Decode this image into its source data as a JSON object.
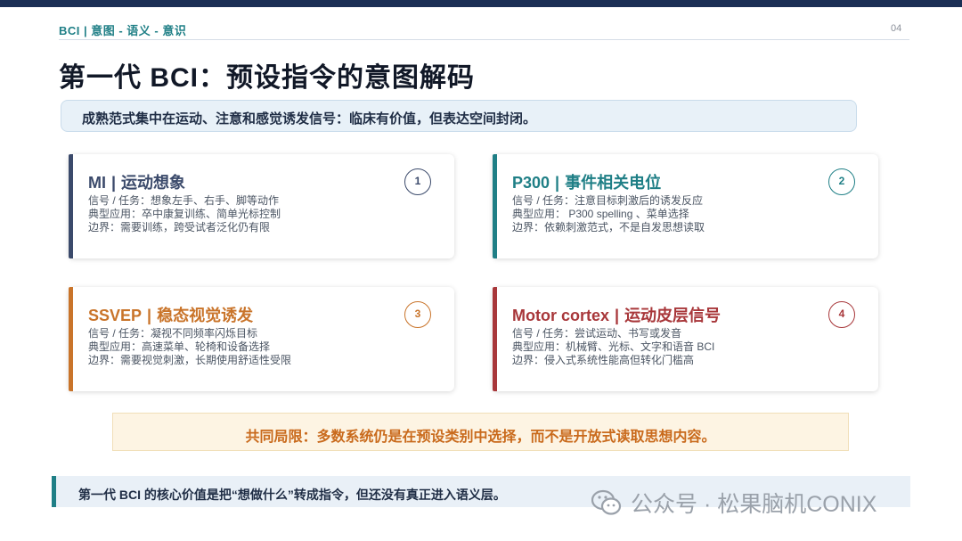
{
  "header": {
    "breadcrumb": "BCI | 意图 - 语义 - 意识",
    "page_number": "04"
  },
  "title": "第一代 BCI：预设指令的意图解码",
  "subtitle": "成熟范式集中在运动、注意和感觉诱发信号：临床有价值，但表达空间封闭。",
  "cards": [
    {
      "abbr": "MI",
      "name": "运动想象",
      "number": "1",
      "color": "#3b4a6b",
      "lines": [
        "信号 / 任务：想象左手、右手、脚等动作",
        "典型应用：卒中康复训练、简单光标控制",
        "边界：需要训练，跨受试者泛化仍有限"
      ]
    },
    {
      "abbr": "P300",
      "name": "事件相关电位",
      "number": "2",
      "color": "#1f7f86",
      "lines": [
        "信号 / 任务：注意目标刺激后的诱发反应",
        "典型应用： P300 spelling 、菜单选择",
        "边界：依赖刺激范式，不是自发思想读取"
      ]
    },
    {
      "abbr": "SSVEP",
      "name": "稳态视觉诱发",
      "number": "3",
      "color": "#c9742a",
      "lines": [
        "信号 / 任务：凝视不同频率闪烁目标",
        "典型应用：高速菜单、轮椅和设备选择",
        "边界：需要视觉刺激，长期使用舒适性受限"
      ]
    },
    {
      "abbr": "Motor cortex",
      "name": "运动皮层信号",
      "number": "4",
      "color": "#a8373a",
      "lines": [
        "信号 / 任务：尝试运动、书写或发音",
        "典型应用：机械臂、光标、文字和语音 BCI",
        "边界：侵入式系统性能高但转化门槛高"
      ]
    }
  ],
  "limitation": "共同局限：多数系统仍是在预设类别中选择，而不是开放式读取思想内容。",
  "footer": "第一代 BCI 的核心价值是把“想做什么”转成指令，但还没有真正进入语义层。",
  "watermark": "公众号 · 松果脑机CONIX"
}
